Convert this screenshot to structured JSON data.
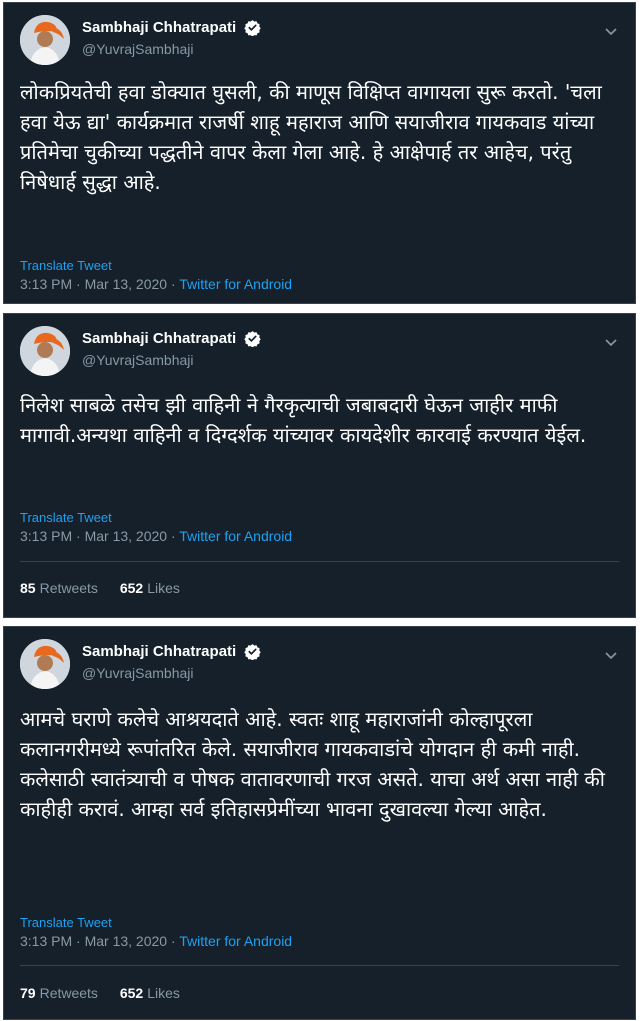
{
  "colors": {
    "background": "#15202b",
    "border": "#38444d",
    "accent": "#1da1f2",
    "secondary_text": "#8899a6",
    "primary_text": "#ffffff",
    "verified_badge": "#ffffff"
  },
  "icons": {
    "verified": "verified-badge-icon",
    "menu": "chevron-down-icon"
  },
  "tweets": [
    {
      "author_name": "Sambhaji Chhatrapati",
      "author_handle": "@YuvrajSambhaji",
      "text": "लोकप्रियतेची हवा डोक्यात घुसली,  की माणूस विक्षिप्त वागायला सुरू करतो. 'चला हवा येऊ द्या' कार्यक्रमात राजर्षी शाहू महाराज आणि सयाजीराव गायकवाड यांच्या प्रतिमेचा चुकीच्या पद्धतीने वापर केला गेला आहे. हे आक्षेपार्ह तर आहेच, परंतु निषेधार्ह सुद्धा आहे.",
      "translate_label": "Translate Tweet",
      "timestamp": "3:13 PM · Mar 13, 2020 · ",
      "source": "Twitter for Android"
    },
    {
      "author_name": "Sambhaji Chhatrapati",
      "author_handle": "@YuvrajSambhaji",
      "text": "निलेश साबळे तसेच झी वाहिनी ने गैरकृत्याची जबाबदारी घेऊन जाहीर माफी मागावी.अन्यथा वाहिनी व दिग्दर्शक यांच्यावर कायदेशीर कारवाई करण्यात येईल.",
      "translate_label": "Translate Tweet",
      "timestamp": "3:13 PM · Mar 13, 2020 · ",
      "source": "Twitter for Android",
      "retweets_count": "85",
      "retweets_label": "Retweets",
      "likes_count": "652",
      "likes_label": "Likes"
    },
    {
      "author_name": "Sambhaji Chhatrapati",
      "author_handle": "@YuvrajSambhaji",
      "text": "आमचे घराणे कलेचे आश्रयदाते आहे. स्वतः शाहू महाराजांनी कोल्हापूरला कलानगरीमध्ये रूपांतरित केले. सयाजीराव गायकवाडांचे योगदान ही कमी नाही. कलेसाठी स्वातंत्र्याची व पोषक वातावरणाची गरज असते. याचा अर्थ असा नाही की काहीही करावं. आम्हा सर्व इतिहासप्रेमींच्या भावना दुखावल्या गेल्या आहेत.",
      "translate_label": "Translate Tweet",
      "timestamp": "3:13 PM · Mar 13, 2020 · ",
      "source": "Twitter for Android",
      "retweets_count": "79",
      "retweets_label": "Retweets",
      "likes_count": "652",
      "likes_label": "Likes"
    }
  ]
}
